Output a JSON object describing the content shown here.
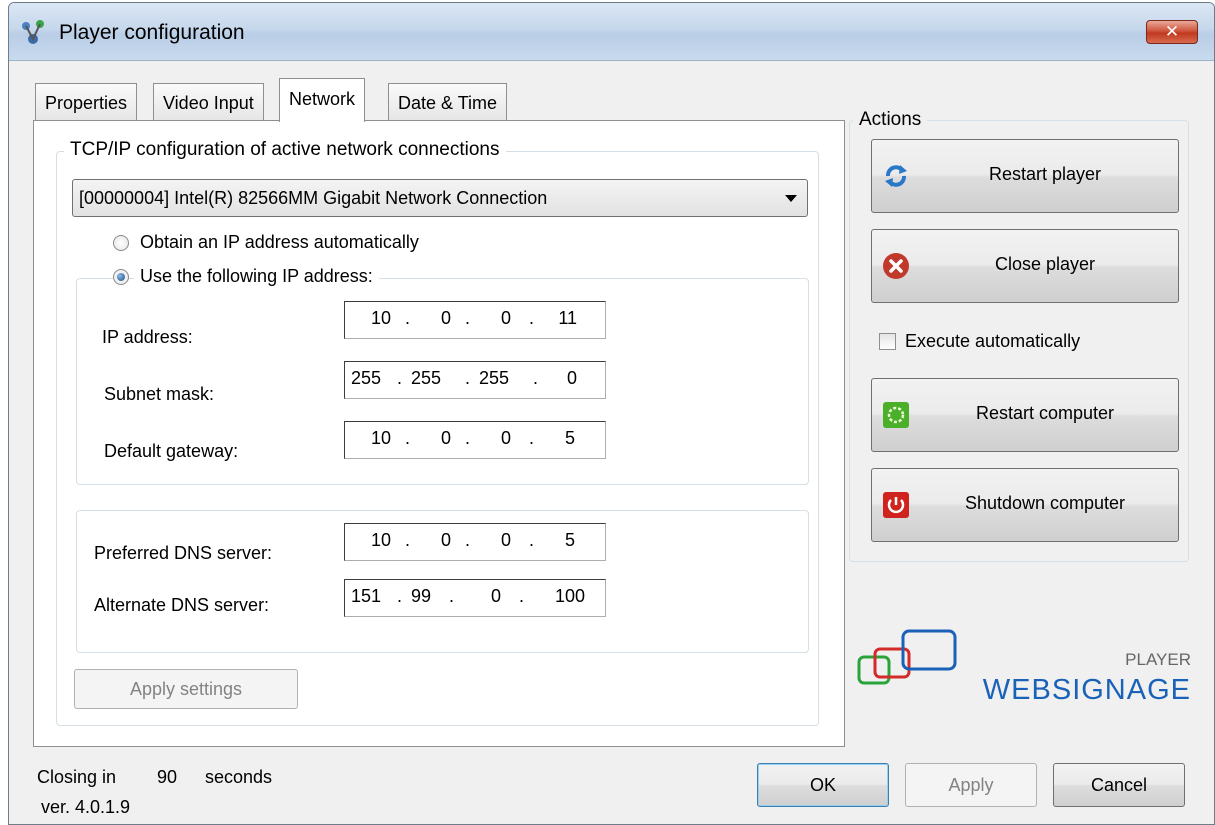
{
  "window": {
    "title": "Player configuration",
    "close_glyph": "✕"
  },
  "tabs": [
    {
      "label": "Properties",
      "active": false
    },
    {
      "label": "Video Input",
      "active": false
    },
    {
      "label": "Network",
      "active": true
    },
    {
      "label": "Date & Time",
      "active": false
    }
  ],
  "network": {
    "group_label": "TCP/IP configuration of active network connections",
    "adapter_selected": "[00000004] Intel(R) 82566MM Gigabit Network Connection",
    "radio_auto_label": "Obtain an IP address automatically",
    "radio_manual_label": "Use the following IP address:",
    "selected_mode": "manual",
    "ip_label": "IP address:",
    "ip": [
      "10",
      "0",
      "0",
      "11"
    ],
    "subnet_label": "Subnet mask:",
    "subnet": [
      "255",
      "255",
      "255",
      "0"
    ],
    "gateway_label": "Default gateway:",
    "gateway": [
      "10",
      "0",
      "0",
      "5"
    ],
    "dns1_label": "Preferred DNS server:",
    "dns1": [
      "10",
      "0",
      "0",
      "5"
    ],
    "dns2_label": "Alternate DNS server:",
    "dns2": [
      "151",
      "99",
      "0",
      "100"
    ],
    "apply_settings_label": "Apply settings"
  },
  "actions": {
    "group_label": "Actions",
    "restart_player": "Restart player",
    "close_player": "Close player",
    "execute_auto_label": "Execute automatically",
    "execute_auto_checked": false,
    "restart_computer": "Restart computer",
    "shutdown_computer": "Shutdown computer"
  },
  "logo": {
    "top": "PLAYER",
    "name": "WEBSIGNAGE"
  },
  "footer": {
    "closing_prefix": "Closing in",
    "closing_seconds": "90",
    "closing_suffix": "seconds",
    "version": "ver. 4.0.1.9",
    "ok": "OK",
    "apply": "Apply",
    "cancel": "Cancel"
  },
  "colors": {
    "title_gradient": "#c6d8ec",
    "close_red": "#c0391f",
    "logo_blue": "#1a62b8",
    "logo_green": "#2aa43a",
    "logo_red": "#d32a2a"
  }
}
